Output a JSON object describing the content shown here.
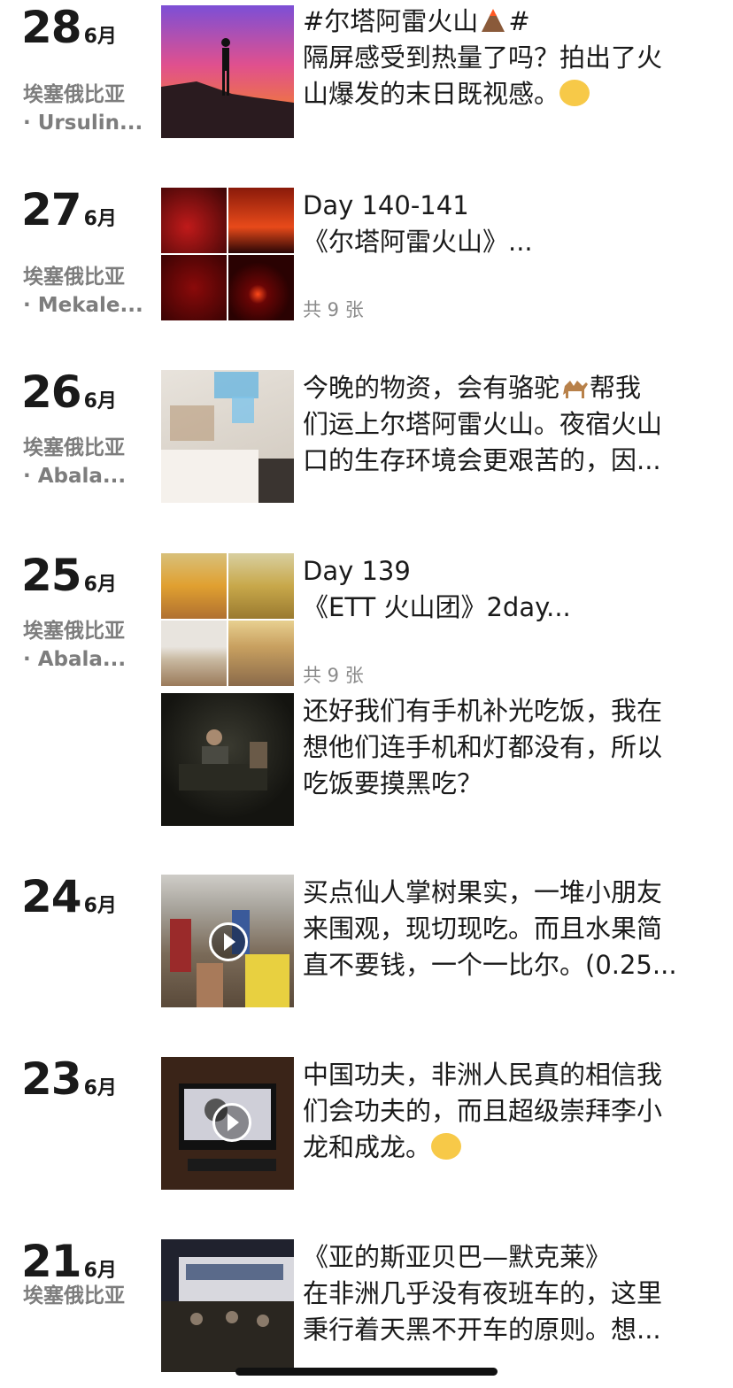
{
  "entries": [
    {
      "day": "28",
      "month": "6月",
      "loc1": "埃塞俄比亚",
      "loc2": "· Ursulin...",
      "text": [
        "#尔塔阿雷火山",
        "#",
        "隔屏感受到热量了吗？拍出了火",
        "山爆发的末日既视感。"
      ],
      "emoji1": "volcano-icon",
      "emoji2": "smirk-face-icon"
    },
    {
      "day": "27",
      "month": "6月",
      "loc1": "埃塞俄比亚",
      "loc2": "· Mekale...",
      "text": [
        "Day 140-141",
        "《尔塔阿雷火山》..."
      ],
      "count": "共 9 张"
    },
    {
      "day": "26",
      "month": "6月",
      "loc1": "埃塞俄比亚",
      "loc2": "· Abala...",
      "text": [
        "今晚的物资，会有骆驼",
        "帮我",
        "们运上尔塔阿雷火山。夜宿火山",
        "口的生存环境会更艰苦的，因..."
      ],
      "emoji1": "camel-icon"
    },
    {
      "day": "25",
      "month": "6月",
      "loc1": "埃塞俄比亚",
      "loc2": "· Abala...",
      "text": [
        "Day 139",
        "《ETT 火山团》2day...",
        "还好我们有手机补光吃饭，我在",
        "想他们连手机和灯都没有，所以",
        "吃饭要摸黑吃？"
      ],
      "count": "共 9 张"
    },
    {
      "day": "24",
      "month": "6月",
      "text": [
        "买点仙人掌树果实，一堆小朋友",
        "来围观，现切现吃。而且水果简",
        "直不要钱，一个一比尔。(0.25..."
      ]
    },
    {
      "day": "23",
      "month": "6月",
      "text": [
        "中国功夫，非洲人民真的相信我",
        "们会功夫的，而且超级崇拜李小",
        "龙和成龙。"
      ],
      "emoji1": "thinking-face-icon"
    },
    {
      "day": "21",
      "month": "6月",
      "loc1": "埃塞俄比亚",
      "text": [
        "《亚的斯亚贝巴—默克莱》",
        "在非洲几乎没有夜班车的，这里",
        "秉行着天黑不开车的原则。想..."
      ]
    }
  ]
}
